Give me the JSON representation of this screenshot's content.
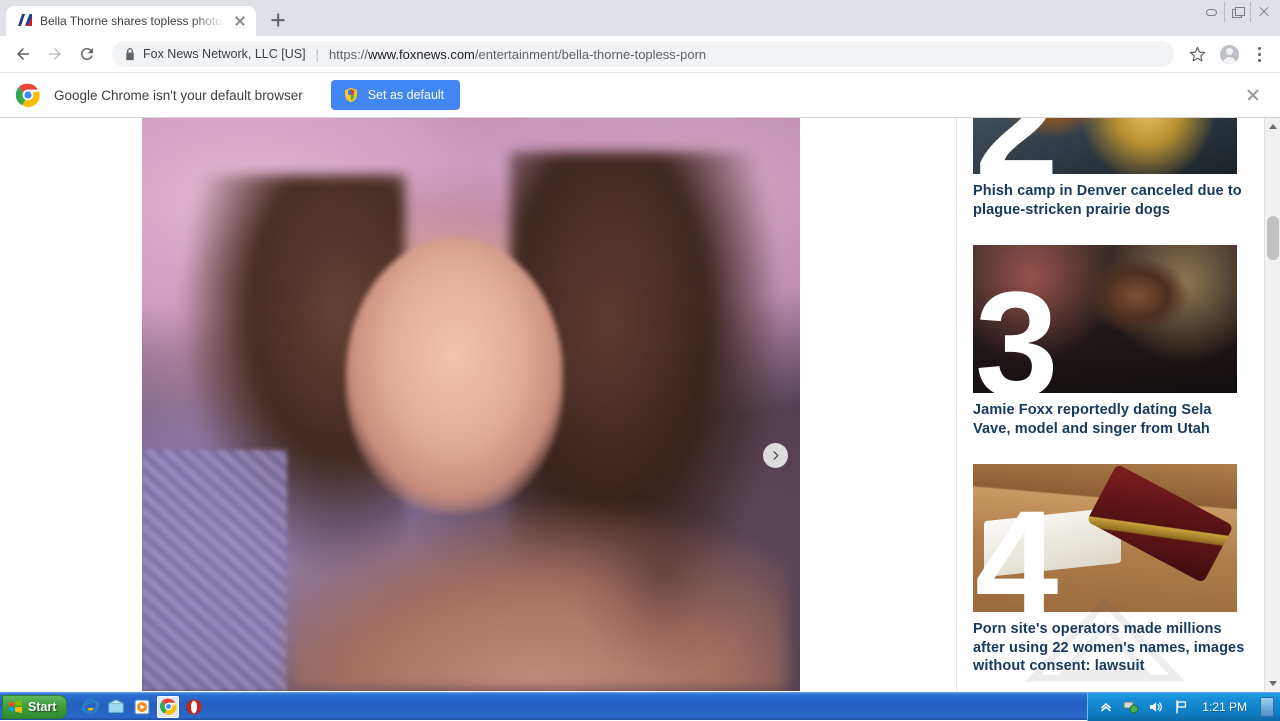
{
  "browser": {
    "tab": {
      "title": "Bella Thorne shares topless photos i",
      "favicon": "foxnews-favicon",
      "close_label": "Close tab"
    },
    "new_tab_label": "New tab",
    "window_controls": {
      "minimize": "Minimize",
      "restore": "Restore",
      "close": "Close"
    },
    "toolbar": {
      "back_label": "Back",
      "forward_label": "Forward",
      "reload_label": "Reload",
      "bookmark_label": "Bookmark this page",
      "profile_label": "Profile",
      "menu_label": "Customize and control Google Chrome"
    },
    "omnibox": {
      "site_identity": "Fox News Network, LLC [US]",
      "separator": "|",
      "url_scheme": "https://",
      "url_host": "www.foxnews.com",
      "url_path": "/entertainment/bella-thorne-topless-porn",
      "lock_icon": "lock-icon"
    },
    "infobar": {
      "message": "Google Chrome isn't your default browser",
      "button_label": "Set as default",
      "close_label": "Close",
      "button_color": "#4285f4",
      "shield_icon": "windows-shield-icon",
      "logo_icon": "chrome-logo-icon"
    }
  },
  "page": {
    "hero": {
      "alt": "Bella Thorne portrait photo",
      "next_label": "Next image",
      "next_icon": "chevron-right-icon"
    },
    "trending": [
      {
        "rank": "2",
        "title": "Phish camp in Denver canceled due to plague-stricken prairie dogs",
        "thumb": "concert-drums-photo"
      },
      {
        "rank": "3",
        "title": "Jamie Foxx reportedly dating Sela Vave, model and singer from Utah",
        "thumb": "jamie-foxx-portrait-photo"
      },
      {
        "rank": "4",
        "title": "Porn site's operators made millions after using 22 women's names, images without consent: lawsuit",
        "thumb": "gavel-law-book-photo"
      }
    ],
    "headline_color": "#16395e",
    "scrollbar": {
      "up_label": "Scroll up",
      "down_label": "Scroll down",
      "thumb_label": "Vertical scrollbar"
    }
  },
  "taskbar": {
    "start_label": "Start",
    "quick_launch": [
      {
        "name": "internet-explorer-icon",
        "label": "Internet Explorer"
      },
      {
        "name": "show-desktop-icon",
        "label": "Show Desktop"
      },
      {
        "name": "media-player-icon",
        "label": "Windows Media Player"
      },
      {
        "name": "google-chrome-icon",
        "label": "Google Chrome"
      },
      {
        "name": "opera-icon",
        "label": "Opera"
      }
    ],
    "tray": [
      {
        "name": "show-hidden-icons-icon",
        "label": "Show hidden icons"
      },
      {
        "name": "network-icon",
        "label": "Network"
      },
      {
        "name": "volume-icon",
        "label": "Volume"
      },
      {
        "name": "flag-icon",
        "label": "Action Center"
      }
    ],
    "clock": "1:21 PM",
    "show_desktop_label": "Show desktop"
  }
}
